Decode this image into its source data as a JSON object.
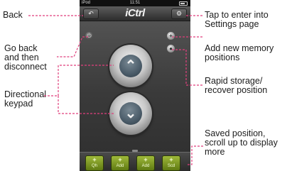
{
  "annotations": {
    "back": "Back",
    "settings_line1": "Tap to enter into",
    "settings_line2": "Settings page",
    "disconnect_line1": "Go back",
    "disconnect_line2": "and then",
    "disconnect_line3": "disconnect",
    "add_memory_line1": "Add new memory",
    "add_memory_line2": "positions",
    "rapid_line1": "Rapid storage/",
    "rapid_line2": "recover position",
    "dpad_line1": "Directional",
    "dpad_line2": "keypad",
    "saved_line1": "Saved position,",
    "saved_line2": "scroll up to display",
    "saved_line3": "more"
  },
  "phone": {
    "status": {
      "carrier": "iPod",
      "time": "11:51"
    },
    "navbar": {
      "title": "iCtrl",
      "back_icon": "back-arrow-icon",
      "settings_icon": "gear-icon"
    },
    "side_buttons": {
      "disconnect_icon": "power-icon",
      "add_icon": "plus-icon",
      "store_icon": "record-icon"
    },
    "dpad": {
      "up_icon": "chevron-up-icon",
      "down_icon": "chevron-down-icon"
    },
    "saved_positions": [
      {
        "label": "Qh"
      },
      {
        "label": "Add"
      },
      {
        "label": "Add"
      },
      {
        "label": "Scd"
      }
    ]
  }
}
